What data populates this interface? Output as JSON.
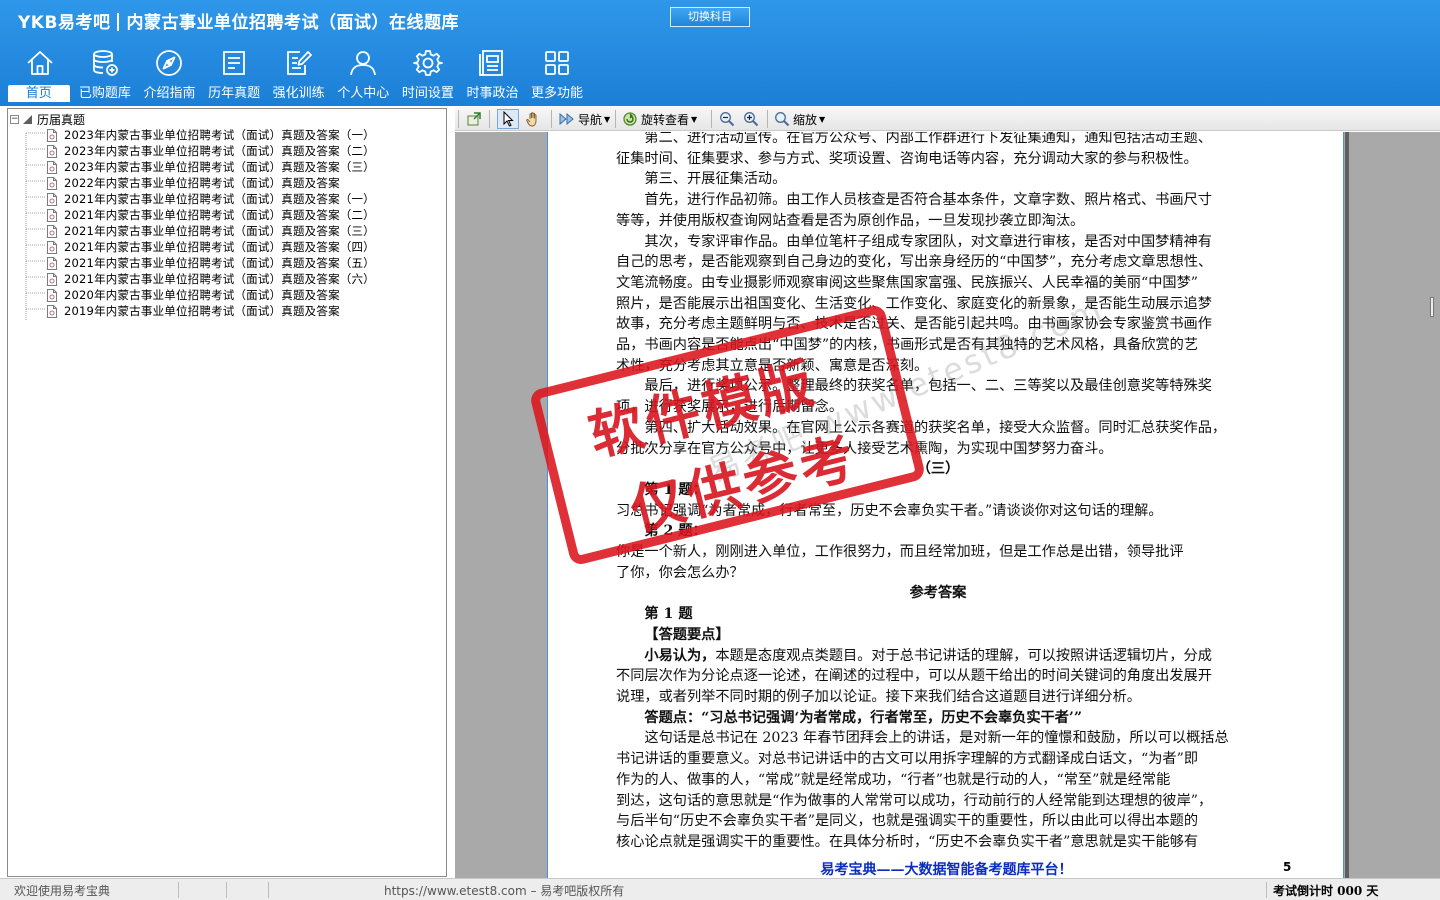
{
  "app": {
    "brand": "YKB易考吧",
    "title": "内蒙古事业单位招聘考试（面试）在线题库",
    "switch_subject": "切换科目"
  },
  "nav": [
    {
      "label": "首页",
      "icon": "home-icon"
    },
    {
      "label": "已购题库",
      "icon": "database-icon"
    },
    {
      "label": "介绍指南",
      "icon": "compass-icon"
    },
    {
      "label": "历年真题",
      "icon": "document-list-icon"
    },
    {
      "label": "强化训练",
      "icon": "edit-document-icon"
    },
    {
      "label": "个人中心",
      "icon": "user-icon"
    },
    {
      "label": "时间设置",
      "icon": "gear-icon"
    },
    {
      "label": "时事政治",
      "icon": "news-icon"
    },
    {
      "label": "更多功能",
      "icon": "grid-icon"
    }
  ],
  "tree": {
    "root": "历届真题",
    "items": [
      "2023年内蒙古事业单位招聘考试（面试）真题及答案（一）",
      "2023年内蒙古事业单位招聘考试（面试）真题及答案（二）",
      "2023年内蒙古事业单位招聘考试（面试）真题及答案（三）",
      "2022年内蒙古事业单位招聘考试（面试）真题及答案",
      "2021年内蒙古事业单位招聘考试（面试）真题及答案（一）",
      "2021年内蒙古事业单位招聘考试（面试）真题及答案（二）",
      "2021年内蒙古事业单位招聘考试（面试）真题及答案（三）",
      "2021年内蒙古事业单位招聘考试（面试）真题及答案（四）",
      "2021年内蒙古事业单位招聘考试（面试）真题及答案（五）",
      "2021年内蒙古事业单位招聘考试（面试）真题及答案（六）",
      "2020年内蒙古事业单位招聘考试（面试）真题及答案",
      "2019年内蒙古事业单位招聘考试（面试）真题及答案"
    ]
  },
  "toolbar": {
    "navigate": "导航",
    "rotate": "旋转查看",
    "zoom": "缩放"
  },
  "document": {
    "lines": [
      "第二、进行活动宣传。在官方公众号、内部工作群进行下发征集通知，通知包括活动主题、",
      "征集时间、征集要求、参与方式、奖项设置、咨询电话等内容，充分调动大家的参与积极性。",
      "第三、开展征集活动。",
      "首先，进行作品初筛。由工作人员核查是否符合基本条件，文章字数、照片格式、书画尺寸",
      "等等，并使用版权查询网站查看是否为原创作品，一旦发现抄袭立即淘汰。",
      "其次，专家评审作品。由单位笔杆子组成专家团队，对文章进行审核，是否对中国梦精神有",
      "自己的思考，是否能观察到自己身边的变化，写出亲身经历的“中国梦”，充分考虑文章思想性、",
      "文笔流畅度。由专业摄影师观察审阅这些聚焦国家富强、民族振兴、人民幸福的美丽“中国梦”",
      "照片，是否能展示出祖国变化、生活变化、工作变化、家庭变化的新景象，是否能生动展示追梦",
      "故事，充分考虑主题鲜明与否、技术是否过关、是否能引起共鸣。由书画家协会专家鉴赏书画作",
      "品，书画内容是否能点出“中国梦”的内核，书画形式是否有其独特的艺术风格，具备欣赏的艺",
      "术性，充分考虑其立意是否新颖、寓意是否深刻。",
      "最后，进行奖项公示。整理最终的获奖名单，包括一、二、三等奖以及最佳创意奖等特殊奖",
      "项，进行获奖展示，进行后期留念。",
      "第四、扩大活动效果。在官网上公示各赛道的获奖名单，接受大众监督。同时汇总获奖作品，",
      "分批次分享在官方公众号中，让更多人接受艺术熏陶，为实现中国梦努力奋斗。",
      "（三）",
      "第 1 题：",
      "习总书记强调“为者常成，行者常至，历史不会辜负实干者。”请谈谈你对这句话的理解。",
      "第 2 题：",
      "你是一个新人，刚刚进入单位，工作很努力，而且经常加班，但是工作总是出错，领导批评",
      "了你，你会怎么办？",
      "参考答案",
      "第 1 题",
      "【答题要点】",
      "小易认为，",
      "本题是态度观点类题目。对于总书记讲话的理解，可以按照讲话逻辑切片，分成",
      "不同层次作为分论点逐一论述，在阐述的过程中，可以从题干给出的时间关键词的角度出发展开",
      "说理，或者列举不同时期的例子加以论证。接下来我们结合这道题目进行详细分析。",
      "答题点：“习总书记强调‘为者常成，行者常至，历史不会辜负实干者’”",
      "这句话是总书记在 2023 年春节团拜会上的讲话，是对新一年的憧憬和鼓励，所以可以概括总",
      "书记讲话的重要意义。对总书记讲话中的古文可以用拆字理解的方式翻译成白话文，“为者”即",
      "作为的人、做事的人，“常成”就是经常成功，“行者”也就是行动的人，“常至”就是经常能",
      "到达，这句话的意思就是“作为做事的人常常可以成功，行动前行的人经常能到达理想的彼岸”，",
      "与后半句“历史不会辜负实干者”是同义，也就是强调实干的重要性，所以由此可以得出本题的",
      "核心论点就是强调实干的重要性。在具体分析时，“历史不会辜负实干者”意思就是实干能够有"
    ],
    "footer": "易考宝典——大数据智能备考题库平台！",
    "page_number": "5",
    "watermark_text": "易考吧 www.etest8.com",
    "stamp_line1": "软件模版",
    "stamp_line2": "仅供参考"
  },
  "status": {
    "welcome": "欢迎使用易考宝典",
    "copyright": "https://www.etest8.com – 易考吧版权所有",
    "countdown": "考试倒计时 000 天"
  }
}
